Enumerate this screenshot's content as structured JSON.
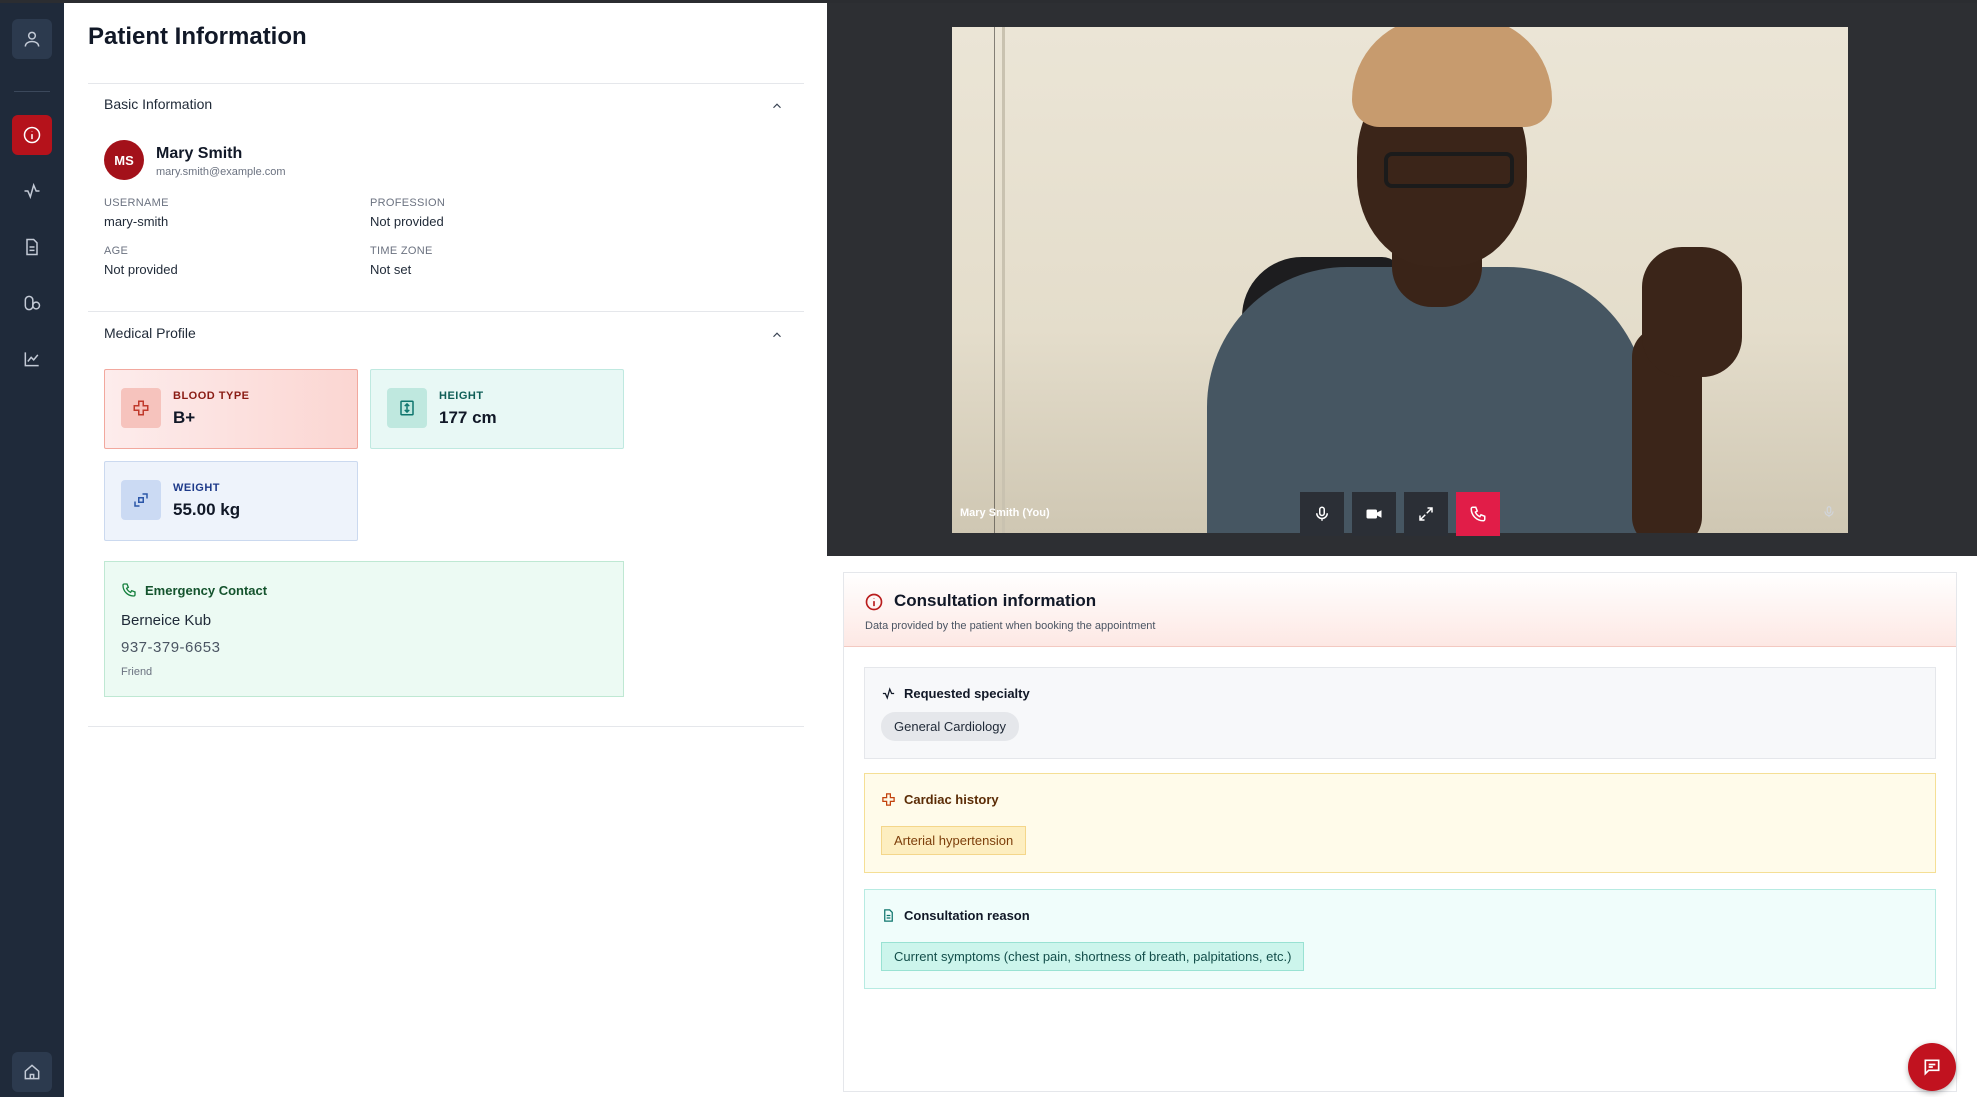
{
  "patient_panel": {
    "title": "Patient Information",
    "basic_section": {
      "heading": "Basic Information",
      "initials": "MS",
      "name": "Mary Smith",
      "email": "mary.smith@example.com",
      "fields": {
        "username_label": "USERNAME",
        "username_value": "mary-smith",
        "profession_label": "PROFESSION",
        "profession_value": "Not provided",
        "age_label": "AGE",
        "age_value": "Not provided",
        "timezone_label": "TIME ZONE",
        "timezone_value": "Not set"
      }
    },
    "medical_section": {
      "heading": "Medical Profile",
      "blood_type_label": "BLOOD TYPE",
      "blood_type_value": "B+",
      "height_label": "HEIGHT",
      "height_value": "177 cm",
      "weight_label": "WEIGHT",
      "weight_value": "55.00 kg"
    },
    "emergency_contact": {
      "heading": "Emergency Contact",
      "name": "Berneice Kub",
      "phone": "937-379-6653",
      "relation": "Friend"
    }
  },
  "video": {
    "participant_label": "Mary Smith (You)"
  },
  "consultation": {
    "title": "Consultation information",
    "subtitle": "Data provided by the patient when booking the appointment",
    "specialty": {
      "heading": "Requested specialty",
      "value": "General Cardiology"
    },
    "cardiac_history": {
      "heading": "Cardiac history",
      "value": "Arterial hypertension"
    },
    "reason": {
      "heading": "Consultation reason",
      "value": "Current symptoms (chest pain, shortness of breath, palpitations, etc.)"
    }
  },
  "colors": {
    "sidebar_bg": "#1f2a3a",
    "accent_red": "#b5121b",
    "hangup": "#e11d48"
  },
  "icons": {
    "sidebar": [
      "user-icon",
      "info-icon",
      "activity-icon",
      "document-icon",
      "pills-icon",
      "chart-icon",
      "home-icon"
    ],
    "video_controls": [
      "microphone-icon",
      "camera-icon",
      "fullscreen-icon",
      "phone-hangup-icon"
    ]
  }
}
